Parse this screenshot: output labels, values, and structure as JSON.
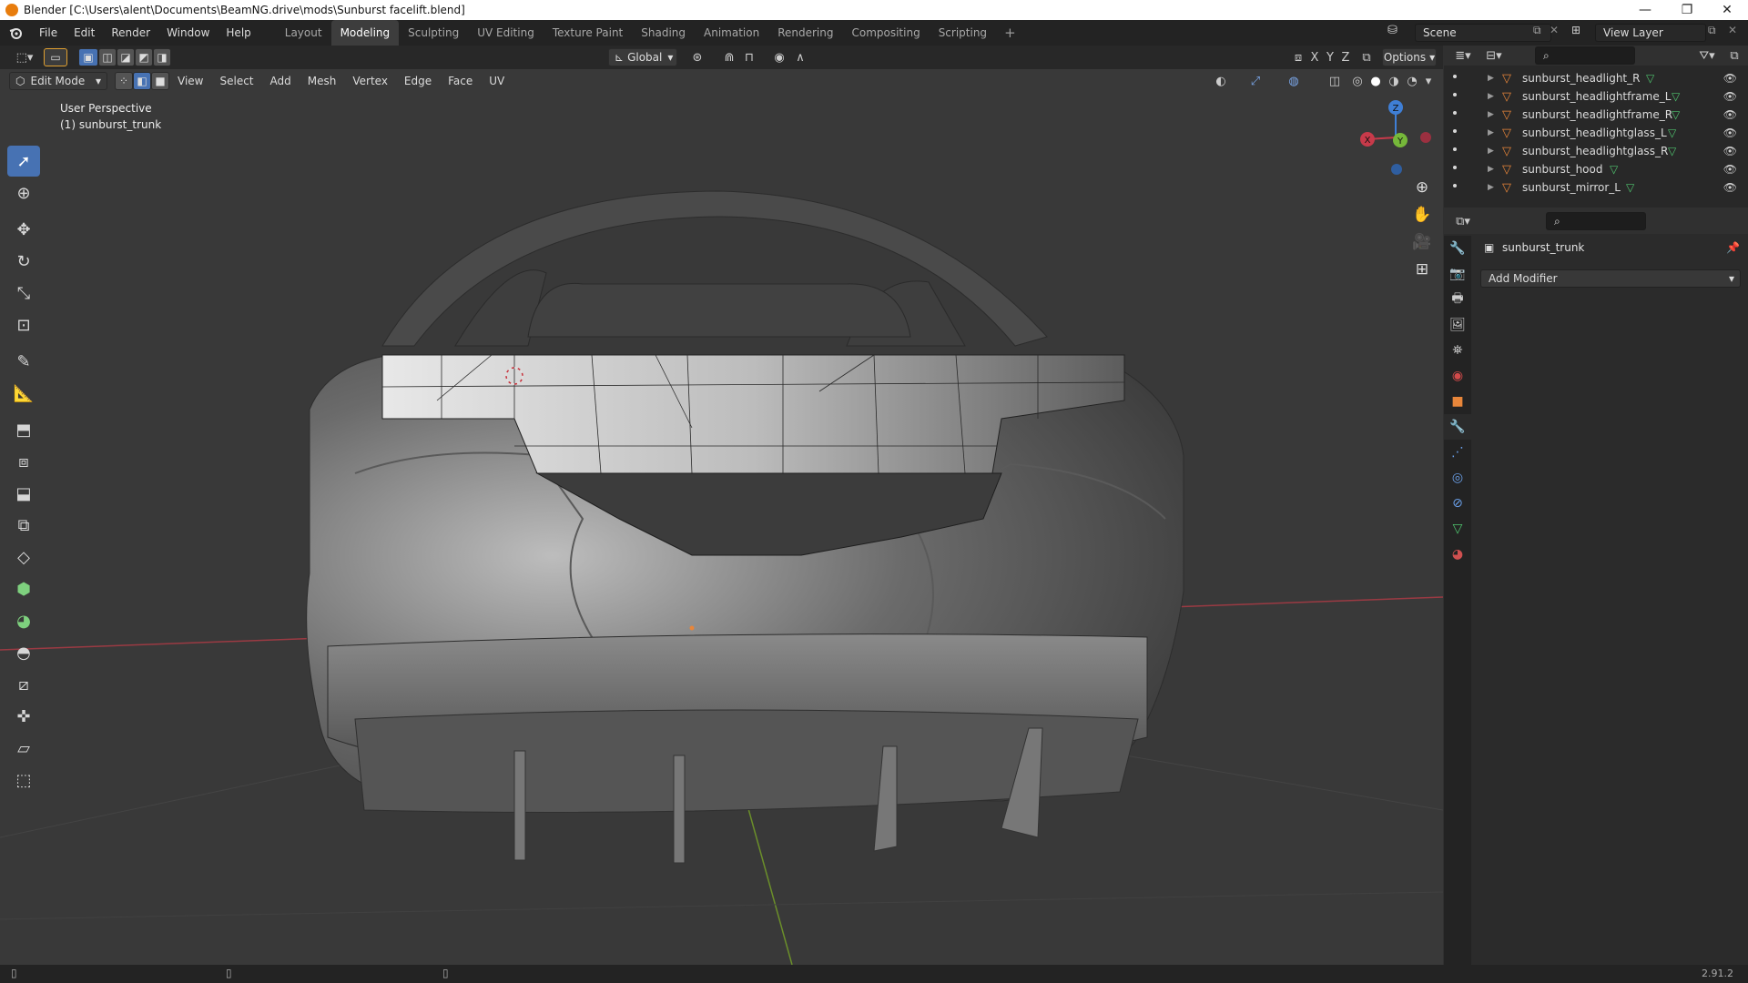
{
  "window_title": "Blender [C:\\Users\\alent\\Documents\\BeamNG.drive\\mods\\Sunburst facelift.blend]",
  "menu": [
    "File",
    "Edit",
    "Render",
    "Window",
    "Help"
  ],
  "workspaces": [
    "Layout",
    "Modeling",
    "Sculpting",
    "UV Editing",
    "Texture Paint",
    "Shading",
    "Animation",
    "Rendering",
    "Compositing",
    "Scripting"
  ],
  "active_workspace": "Modeling",
  "scene_name": "Scene",
  "view_layer": "View Layer",
  "viewport_header": {
    "transform_orientation": "Global",
    "options_label": "Options",
    "axes": [
      "X",
      "Y",
      "Z"
    ]
  },
  "edit_header": {
    "mode": "Edit Mode",
    "menus": [
      "View",
      "Select",
      "Add",
      "Mesh",
      "Vertex",
      "Edge",
      "Face",
      "UV"
    ]
  },
  "viewport_overlay": {
    "perspective": "User Perspective",
    "object": "(1) sunburst_trunk"
  },
  "gizmo_axes": {
    "x": "X",
    "y": "Y",
    "z": "Z"
  },
  "outliner_items": [
    {
      "name": "sunburst_headlight_R"
    },
    {
      "name": "sunburst_headlightframe_L"
    },
    {
      "name": "sunburst_headlightframe_R"
    },
    {
      "name": "sunburst_headlightglass_L"
    },
    {
      "name": "sunburst_headlightglass_R"
    },
    {
      "name": "sunburst_hood"
    },
    {
      "name": "sunburst_mirror_L"
    }
  ],
  "properties": {
    "object_name": "sunburst_trunk",
    "add_modifier": "Add Modifier"
  },
  "status_bar": {
    "version": "2.91.2"
  },
  "colors": {
    "accent": "#4772b3",
    "x_axis": "#c73a4a",
    "y_axis": "#76b83a",
    "z_axis": "#3f7fd6",
    "mesh_icon": "#e8863a",
    "active_ws": "#3d3d3d"
  }
}
